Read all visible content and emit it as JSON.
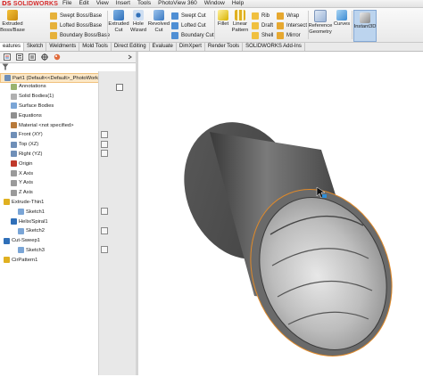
{
  "app": {
    "logo_prefix": "DS",
    "logo_name": "SOLIDWORKS"
  },
  "menus": [
    "File",
    "Edit",
    "View",
    "Insert",
    "Tools",
    "PhotoView 360",
    "Window",
    "Help"
  ],
  "ribbon": {
    "boss_base": "Extruded\nBoss/Base",
    "swept_boss": "Swept Boss/Base",
    "lofted_boss": "Lofted Boss/Base",
    "boundary_boss": "Boundary Boss/Base",
    "extruded_cut": "Extruded\nCut",
    "hole_wizard": "Hole\nWizard",
    "revolved_cut": "Revolved\nCut",
    "swept_cut": "Swept Cut",
    "lofted_cut": "Lofted Cut",
    "boundary_cut": "Boundary Cut",
    "fillet": "Fillet",
    "linear_pattern": "Linear\nPattern",
    "rib": "Rib",
    "draft": "Draft",
    "shell": "Shell",
    "wrap": "Wrap",
    "intersect": "Intersect",
    "mirror": "Mirror",
    "reference_geometry": "Reference\nGeometry",
    "curves": "Curves",
    "instant3d": "Instant3D"
  },
  "tabs": [
    "eatures",
    "Sketch",
    "Weldments",
    "Mold Tools",
    "Direct Editing",
    "Evaluate",
    "DimXpert",
    "Render Tools",
    "SOLIDWORKS Add-Ins"
  ],
  "tree": [
    {
      "label": "Part1  (Default<<Default>_PhotoWorks Di",
      "indent": 0,
      "selected": true
    },
    {
      "label": "Annotations",
      "indent": 1
    },
    {
      "label": "Solid Bodies(1)",
      "indent": 1
    },
    {
      "label": "Surface Bodies",
      "indent": 1
    },
    {
      "label": "Equations",
      "indent": 1
    },
    {
      "label": "Material <not specified>",
      "indent": 1
    },
    {
      "label": "Front (XY)",
      "indent": 1
    },
    {
      "label": "Top (XZ)",
      "indent": 1
    },
    {
      "label": "Right (YZ)",
      "indent": 1
    },
    {
      "label": "Origin",
      "indent": 1
    },
    {
      "label": "X Axis",
      "indent": 1
    },
    {
      "label": "Y Axis",
      "indent": 1
    },
    {
      "label": "Z Axis",
      "indent": 1
    },
    {
      "label": "Extrude-Thin1",
      "indent": 0
    },
    {
      "label": "Sketch1",
      "indent": 2
    },
    {
      "label": "Helix/Spiral1",
      "indent": 1
    },
    {
      "label": "Sketch2",
      "indent": 2
    },
    {
      "label": "Cut-Sweep1",
      "indent": 0
    },
    {
      "label": "Sketch3",
      "indent": 2
    },
    {
      "label": "CirPattern1",
      "indent": 0
    }
  ],
  "colors": {
    "accent": "#d62a2a",
    "selection": "#fbe7c6",
    "edge_highlight": "#e08a2a"
  }
}
